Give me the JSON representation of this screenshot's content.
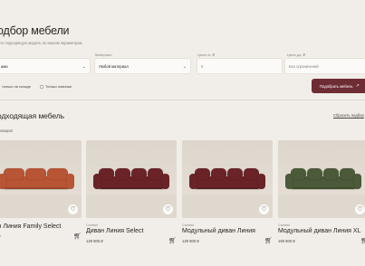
{
  "page": {
    "title": "одбор мебели",
    "subtitle": "те подходящую модель по вашим параметрам."
  },
  "filters": [
    {
      "label": "",
      "value": "ама",
      "kind": "select"
    },
    {
      "label": "Материал",
      "value": "Любой материал",
      "kind": "select"
    },
    {
      "label": "Цена от, ₽",
      "value": "",
      "kind": "input",
      "placeholder": "0"
    },
    {
      "label": "Цена до, ₽",
      "value": "",
      "kind": "input",
      "placeholder": "Без ограничений"
    }
  ],
  "checks": [
    {
      "label": "только на складе"
    },
    {
      "label": "Только новинки"
    }
  ],
  "submit": {
    "label": "Подобрать мебель",
    "icon": "arrow-right-icon"
  },
  "section": {
    "title": "одходящая мебель",
    "reset": "Сбросить подбор",
    "count": "оваров"
  },
  "products": [
    {
      "brand": "",
      "name": "ван Линия Family Select",
      "price": "900 ₽",
      "color": "#b85535"
    },
    {
      "brand": "Comfort",
      "name": "Диван Линия Select",
      "price": "129 900 ₽",
      "color": "#6a2428"
    },
    {
      "brand": "Comfort",
      "name": "Модульный диван Линия",
      "price": "129 900 ₽",
      "color": "#6a2428"
    },
    {
      "brand": "Comfort",
      "name": "Модульный диван Линия XL",
      "price": "159 900 ₽",
      "color": "#4b5a39"
    }
  ]
}
